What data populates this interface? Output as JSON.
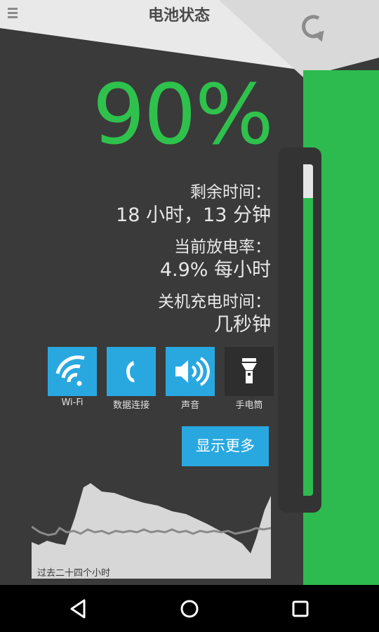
{
  "header": {
    "title": "电池状态",
    "menu_icon": "hamburger-menu-icon",
    "refresh_icon": "refresh-icon"
  },
  "battery": {
    "percent_text": "90%",
    "level_fraction": 0.9
  },
  "stats": {
    "remaining_label": "剩余时间：",
    "remaining_value": "18 小时，13 分钟",
    "discharge_label": "当前放电率：",
    "discharge_value": "4.9% 每小时",
    "charge_label": "关机充电时间：",
    "charge_value": "几秒钟"
  },
  "toggles": [
    {
      "label": "Wi-Fi",
      "icon": "wifi-icon",
      "active": true
    },
    {
      "label": "数据连接",
      "icon": "phone-icon",
      "active": true
    },
    {
      "label": "声音",
      "icon": "speaker-icon",
      "active": true
    },
    {
      "label": "手电筒",
      "icon": "flashlight-icon",
      "active": false
    }
  ],
  "more_button_label": "显示更多",
  "history": {
    "caption": "过去二十四个小时"
  },
  "colors": {
    "accent_green": "#2ec24d",
    "tile_blue": "#29a8e0",
    "background_dark": "#3a3a3a"
  },
  "navbar": {
    "back_icon": "back-icon",
    "home_icon": "home-icon",
    "recents_icon": "recents-icon"
  }
}
